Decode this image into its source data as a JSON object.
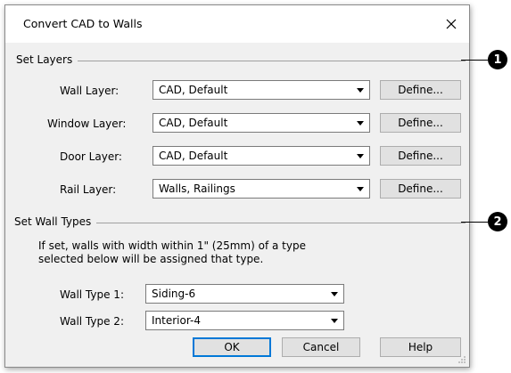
{
  "dialog": {
    "title": "Convert CAD to Walls",
    "close_glyph": "close-icon"
  },
  "set_layers": {
    "label": "Set Layers",
    "callout": "1",
    "rows": [
      {
        "label": "Wall Layer:",
        "value": "CAD,  Default",
        "button": "Define..."
      },
      {
        "label": "Window Layer:",
        "value": "CAD,  Default",
        "button": "Define..."
      },
      {
        "label": "Door Layer:",
        "value": "CAD,  Default",
        "button": "Define..."
      },
      {
        "label": "Rail Layer:",
        "value": "Walls,  Railings",
        "button": "Define..."
      }
    ]
  },
  "set_wall_types": {
    "label": "Set Wall Types",
    "callout": "2",
    "info_line1": "If set, walls with width within 1\" (25mm) of a type",
    "info_line2": "selected below will be assigned that type.",
    "rows": [
      {
        "label": "Wall Type 1:",
        "value": "Siding-6"
      },
      {
        "label": "Wall Type 2:",
        "value": "Interior-4"
      }
    ]
  },
  "buttons": {
    "ok": "OK",
    "cancel": "Cancel",
    "help": "Help"
  },
  "colors": {
    "dialog_bg": "#f0f0f0",
    "default_button_border": "#0078d7",
    "callout_bg": "#000000"
  }
}
